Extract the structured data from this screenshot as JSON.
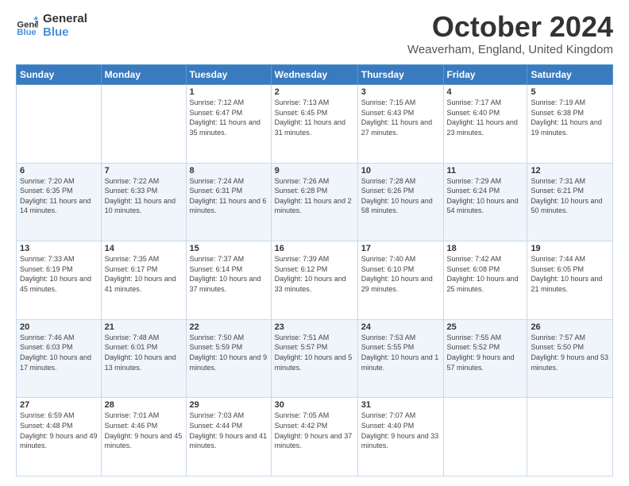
{
  "header": {
    "logo_line1": "General",
    "logo_line2": "Blue",
    "month": "October 2024",
    "location": "Weaverham, England, United Kingdom"
  },
  "weekdays": [
    "Sunday",
    "Monday",
    "Tuesday",
    "Wednesday",
    "Thursday",
    "Friday",
    "Saturday"
  ],
  "weeks": [
    [
      {
        "day": "",
        "sunrise": "",
        "sunset": "",
        "daylight": ""
      },
      {
        "day": "",
        "sunrise": "",
        "sunset": "",
        "daylight": ""
      },
      {
        "day": "1",
        "sunrise": "Sunrise: 7:12 AM",
        "sunset": "Sunset: 6:47 PM",
        "daylight": "Daylight: 11 hours and 35 minutes."
      },
      {
        "day": "2",
        "sunrise": "Sunrise: 7:13 AM",
        "sunset": "Sunset: 6:45 PM",
        "daylight": "Daylight: 11 hours and 31 minutes."
      },
      {
        "day": "3",
        "sunrise": "Sunrise: 7:15 AM",
        "sunset": "Sunset: 6:43 PM",
        "daylight": "Daylight: 11 hours and 27 minutes."
      },
      {
        "day": "4",
        "sunrise": "Sunrise: 7:17 AM",
        "sunset": "Sunset: 6:40 PM",
        "daylight": "Daylight: 11 hours and 23 minutes."
      },
      {
        "day": "5",
        "sunrise": "Sunrise: 7:19 AM",
        "sunset": "Sunset: 6:38 PM",
        "daylight": "Daylight: 11 hours and 19 minutes."
      }
    ],
    [
      {
        "day": "6",
        "sunrise": "Sunrise: 7:20 AM",
        "sunset": "Sunset: 6:35 PM",
        "daylight": "Daylight: 11 hours and 14 minutes."
      },
      {
        "day": "7",
        "sunrise": "Sunrise: 7:22 AM",
        "sunset": "Sunset: 6:33 PM",
        "daylight": "Daylight: 11 hours and 10 minutes."
      },
      {
        "day": "8",
        "sunrise": "Sunrise: 7:24 AM",
        "sunset": "Sunset: 6:31 PM",
        "daylight": "Daylight: 11 hours and 6 minutes."
      },
      {
        "day": "9",
        "sunrise": "Sunrise: 7:26 AM",
        "sunset": "Sunset: 6:28 PM",
        "daylight": "Daylight: 11 hours and 2 minutes."
      },
      {
        "day": "10",
        "sunrise": "Sunrise: 7:28 AM",
        "sunset": "Sunset: 6:26 PM",
        "daylight": "Daylight: 10 hours and 58 minutes."
      },
      {
        "day": "11",
        "sunrise": "Sunrise: 7:29 AM",
        "sunset": "Sunset: 6:24 PM",
        "daylight": "Daylight: 10 hours and 54 minutes."
      },
      {
        "day": "12",
        "sunrise": "Sunrise: 7:31 AM",
        "sunset": "Sunset: 6:21 PM",
        "daylight": "Daylight: 10 hours and 50 minutes."
      }
    ],
    [
      {
        "day": "13",
        "sunrise": "Sunrise: 7:33 AM",
        "sunset": "Sunset: 6:19 PM",
        "daylight": "Daylight: 10 hours and 45 minutes."
      },
      {
        "day": "14",
        "sunrise": "Sunrise: 7:35 AM",
        "sunset": "Sunset: 6:17 PM",
        "daylight": "Daylight: 10 hours and 41 minutes."
      },
      {
        "day": "15",
        "sunrise": "Sunrise: 7:37 AM",
        "sunset": "Sunset: 6:14 PM",
        "daylight": "Daylight: 10 hours and 37 minutes."
      },
      {
        "day": "16",
        "sunrise": "Sunrise: 7:39 AM",
        "sunset": "Sunset: 6:12 PM",
        "daylight": "Daylight: 10 hours and 33 minutes."
      },
      {
        "day": "17",
        "sunrise": "Sunrise: 7:40 AM",
        "sunset": "Sunset: 6:10 PM",
        "daylight": "Daylight: 10 hours and 29 minutes."
      },
      {
        "day": "18",
        "sunrise": "Sunrise: 7:42 AM",
        "sunset": "Sunset: 6:08 PM",
        "daylight": "Daylight: 10 hours and 25 minutes."
      },
      {
        "day": "19",
        "sunrise": "Sunrise: 7:44 AM",
        "sunset": "Sunset: 6:05 PM",
        "daylight": "Daylight: 10 hours and 21 minutes."
      }
    ],
    [
      {
        "day": "20",
        "sunrise": "Sunrise: 7:46 AM",
        "sunset": "Sunset: 6:03 PM",
        "daylight": "Daylight: 10 hours and 17 minutes."
      },
      {
        "day": "21",
        "sunrise": "Sunrise: 7:48 AM",
        "sunset": "Sunset: 6:01 PM",
        "daylight": "Daylight: 10 hours and 13 minutes."
      },
      {
        "day": "22",
        "sunrise": "Sunrise: 7:50 AM",
        "sunset": "Sunset: 5:59 PM",
        "daylight": "Daylight: 10 hours and 9 minutes."
      },
      {
        "day": "23",
        "sunrise": "Sunrise: 7:51 AM",
        "sunset": "Sunset: 5:57 PM",
        "daylight": "Daylight: 10 hours and 5 minutes."
      },
      {
        "day": "24",
        "sunrise": "Sunrise: 7:53 AM",
        "sunset": "Sunset: 5:55 PM",
        "daylight": "Daylight: 10 hours and 1 minute."
      },
      {
        "day": "25",
        "sunrise": "Sunrise: 7:55 AM",
        "sunset": "Sunset: 5:52 PM",
        "daylight": "Daylight: 9 hours and 57 minutes."
      },
      {
        "day": "26",
        "sunrise": "Sunrise: 7:57 AM",
        "sunset": "Sunset: 5:50 PM",
        "daylight": "Daylight: 9 hours and 53 minutes."
      }
    ],
    [
      {
        "day": "27",
        "sunrise": "Sunrise: 6:59 AM",
        "sunset": "Sunset: 4:48 PM",
        "daylight": "Daylight: 9 hours and 49 minutes."
      },
      {
        "day": "28",
        "sunrise": "Sunrise: 7:01 AM",
        "sunset": "Sunset: 4:46 PM",
        "daylight": "Daylight: 9 hours and 45 minutes."
      },
      {
        "day": "29",
        "sunrise": "Sunrise: 7:03 AM",
        "sunset": "Sunset: 4:44 PM",
        "daylight": "Daylight: 9 hours and 41 minutes."
      },
      {
        "day": "30",
        "sunrise": "Sunrise: 7:05 AM",
        "sunset": "Sunset: 4:42 PM",
        "daylight": "Daylight: 9 hours and 37 minutes."
      },
      {
        "day": "31",
        "sunrise": "Sunrise: 7:07 AM",
        "sunset": "Sunset: 4:40 PM",
        "daylight": "Daylight: 9 hours and 33 minutes."
      },
      {
        "day": "",
        "sunrise": "",
        "sunset": "",
        "daylight": ""
      },
      {
        "day": "",
        "sunrise": "",
        "sunset": "",
        "daylight": ""
      }
    ]
  ]
}
